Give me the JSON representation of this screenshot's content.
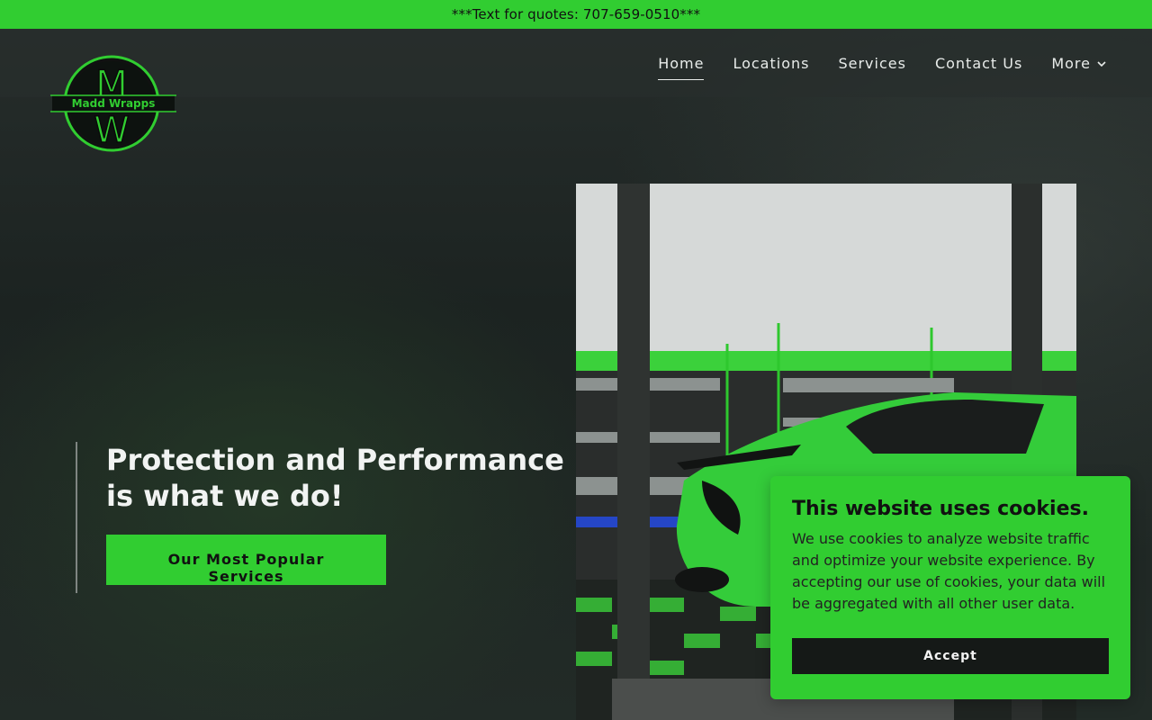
{
  "announcement": {
    "text": "***Text for quotes: 707-659-0510***"
  },
  "brand": {
    "logo_text": "Madd Wrapps",
    "logo_letters_top": "M",
    "logo_letters_bottom": "W",
    "accent": "#31cd31"
  },
  "nav": {
    "items": [
      {
        "label": "Home",
        "active": true
      },
      {
        "label": "Locations",
        "active": false
      },
      {
        "label": "Services",
        "active": false
      },
      {
        "label": "Contact Us",
        "active": false
      }
    ],
    "more_label": "More",
    "more_icon": "chevron-down-icon"
  },
  "hero": {
    "tagline": "Protection and Performance is what we do!",
    "cta_label": "Our Most Popular Services",
    "image_description": "green car in wrap shop"
  },
  "cookie": {
    "title": "This website uses cookies.",
    "body": "We use cookies to analyze website traffic and optimize your website experience. By accepting our use of cookies, your data will be aggregated with all other user data.",
    "accept_label": "Accept"
  }
}
